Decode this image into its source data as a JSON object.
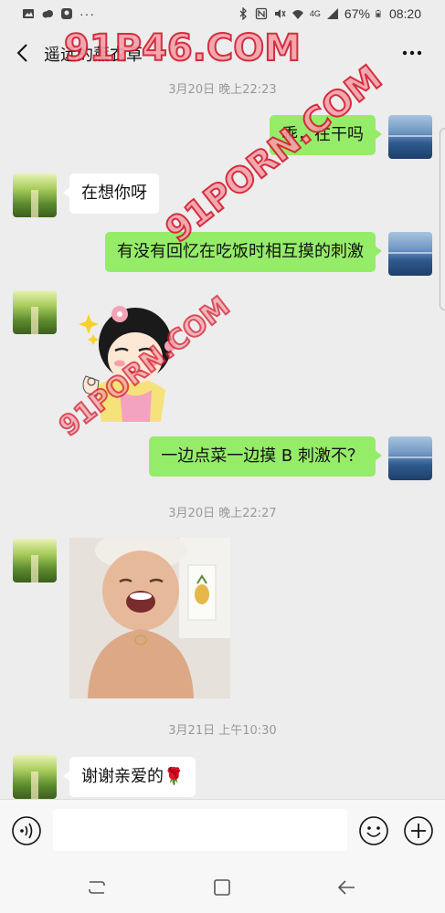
{
  "status_bar": {
    "battery": "67%",
    "time": "08:20",
    "network": "4G"
  },
  "header": {
    "title": "遥远的薰衣草",
    "back_icon": "chevron-left-icon",
    "more_icon": "more-dots-icon"
  },
  "watermarks": [
    "91P46.COM",
    "91PORN.COM",
    "91PORN.COM"
  ],
  "messages": [
    {
      "type": "time",
      "text": "3月20日 晚上22:23"
    },
    {
      "type": "text",
      "side": "right",
      "text": "乖，在干吗"
    },
    {
      "type": "text",
      "side": "left",
      "text": "在想你呀"
    },
    {
      "type": "text",
      "side": "right",
      "text": "有没有回忆在吃饭时相互摸的刺激"
    },
    {
      "type": "sticker",
      "side": "left",
      "text": ""
    },
    {
      "type": "text",
      "side": "right",
      "text": "一边点菜一边摸 B 刺激不？"
    },
    {
      "type": "time",
      "text": "3月20日 晚上22:27"
    },
    {
      "type": "image",
      "side": "left",
      "text": ""
    },
    {
      "type": "time",
      "text": "3月21日 上午10:30"
    },
    {
      "type": "text",
      "side": "left",
      "text": "谢谢亲爱的🌹"
    }
  ],
  "input_bar": {
    "placeholder": "",
    "value": ""
  },
  "colors": {
    "background": "#ededed",
    "bubble_self": "#95ec69",
    "bubble_other": "#ffffff",
    "watermark": "#d21a2e"
  }
}
